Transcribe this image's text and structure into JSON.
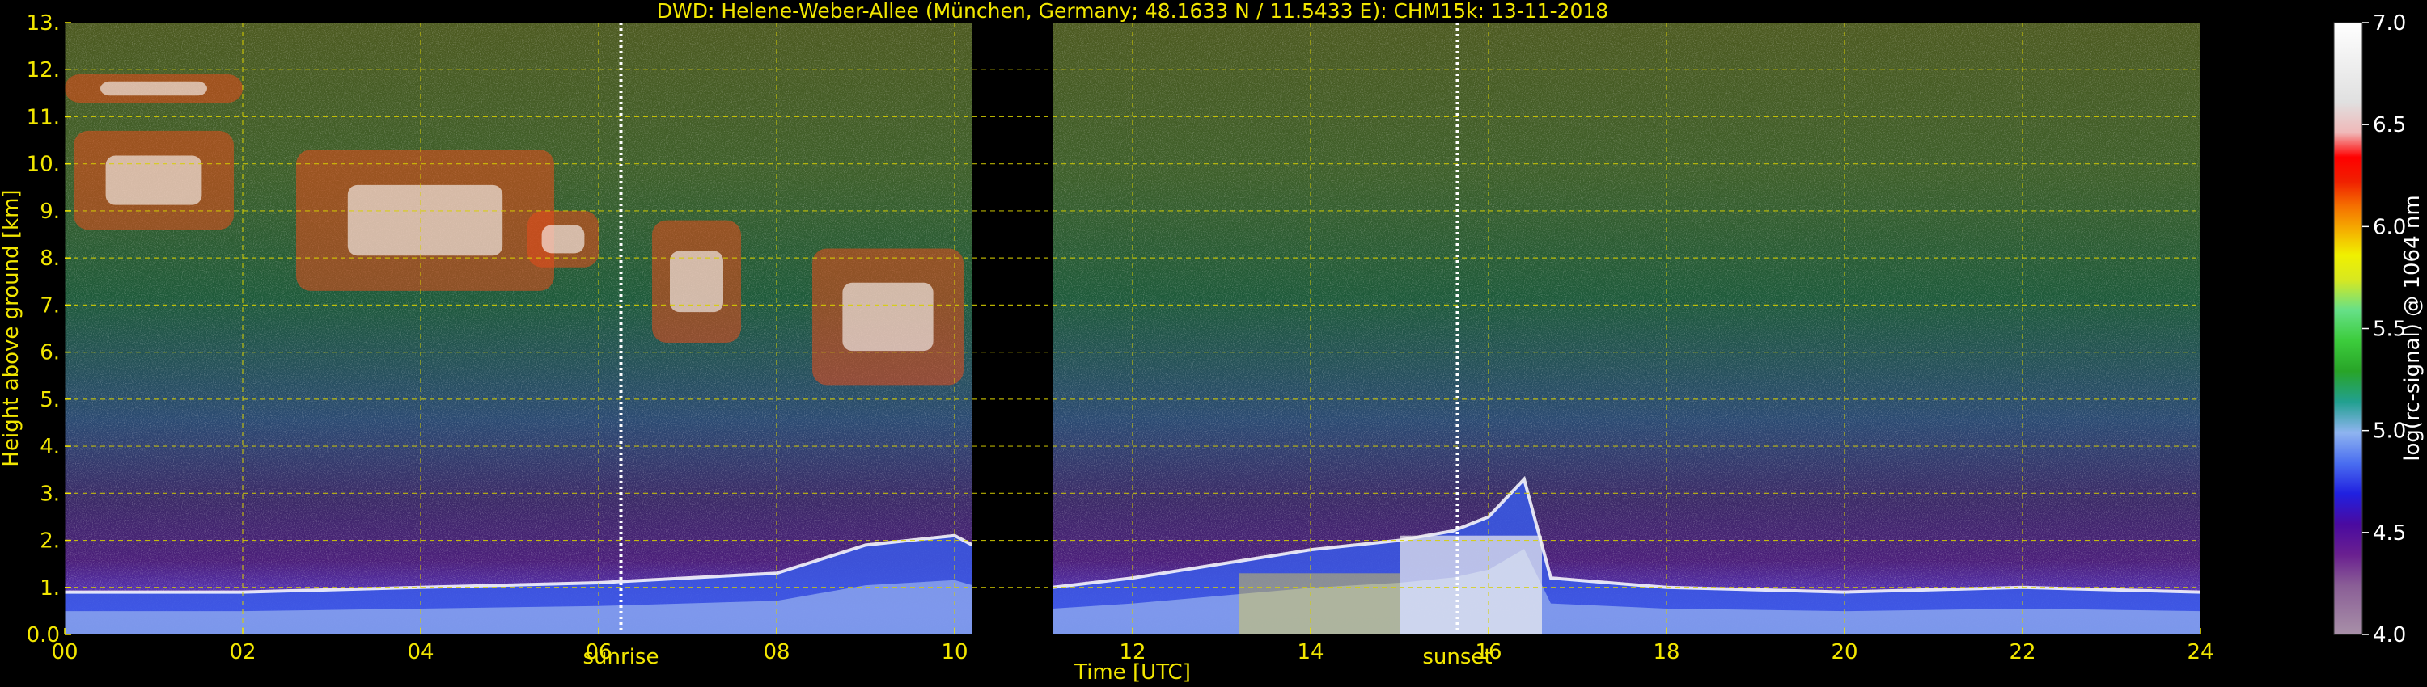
{
  "chart_data": {
    "type": "heatmap",
    "title": "DWD: Helene-Weber-Allee (München, Germany; 48.1633 N / 11.5433 E):    CHM15k: 13-11-2018",
    "xlabel": "Time [UTC]",
    "ylabel": "Height above ground [km]",
    "xlim": [
      0,
      24
    ],
    "ylim": [
      0,
      13
    ],
    "x_ticks": [
      "00",
      "02",
      "04",
      "06",
      "08",
      "10",
      "12",
      "14",
      "16",
      "18",
      "20",
      "22",
      "24"
    ],
    "y_ticks": [
      "0.0",
      "1.",
      "2.",
      "3.",
      "4.",
      "5.",
      "6.",
      "7.",
      "8.",
      "9.",
      "10.",
      "11.",
      "12.",
      "13."
    ],
    "grid": true,
    "annotations": [
      {
        "text": "sunrise",
        "x": 6.25
      },
      {
        "text": "sunset",
        "x": 15.65
      }
    ],
    "data_gap": {
      "x_start": 10.2,
      "x_end": 11.1
    },
    "colorbar": {
      "label": "log(rc-signal) @ 1064 nm",
      "range": [
        4.0,
        7.0
      ],
      "ticks": [
        "4.0",
        "4.5",
        "5.0",
        "5.5",
        "6.0",
        "6.5",
        "7.0"
      ],
      "scale": "log"
    },
    "features": {
      "boundary_layer_top_km": [
        {
          "x": 0,
          "y": 0.9
        },
        {
          "x": 2,
          "y": 0.9
        },
        {
          "x": 4,
          "y": 1.0
        },
        {
          "x": 6,
          "y": 1.1
        },
        {
          "x": 8,
          "y": 1.3
        },
        {
          "x": 9,
          "y": 1.9
        },
        {
          "x": 10,
          "y": 2.1
        },
        {
          "x": 11.1,
          "y": 1.0
        },
        {
          "x": 12,
          "y": 1.2
        },
        {
          "x": 13,
          "y": 1.5
        },
        {
          "x": 14,
          "y": 1.8
        },
        {
          "x": 15,
          "y": 2.0
        },
        {
          "x": 15.6,
          "y": 2.2
        },
        {
          "x": 16,
          "y": 2.5
        },
        {
          "x": 16.4,
          "y": 3.3
        },
        {
          "x": 16.7,
          "y": 1.2
        },
        {
          "x": 18,
          "y": 1.0
        },
        {
          "x": 20,
          "y": 0.9
        },
        {
          "x": 22,
          "y": 1.0
        },
        {
          "x": 24,
          "y": 0.9
        }
      ],
      "high_clouds_km": [
        {
          "x_start": 0.0,
          "x_end": 2.0,
          "base": 11.3,
          "top": 11.9
        },
        {
          "x_start": 0.1,
          "x_end": 1.9,
          "base": 8.6,
          "top": 10.7
        },
        {
          "x_start": 2.6,
          "x_end": 5.5,
          "base": 7.3,
          "top": 10.3
        },
        {
          "x_start": 5.2,
          "x_end": 6.0,
          "base": 7.8,
          "top": 9.0
        },
        {
          "x_start": 6.6,
          "x_end": 7.6,
          "base": 6.2,
          "top": 8.8
        },
        {
          "x_start": 8.4,
          "x_end": 10.1,
          "base": 5.3,
          "top": 8.2
        }
      ]
    }
  }
}
